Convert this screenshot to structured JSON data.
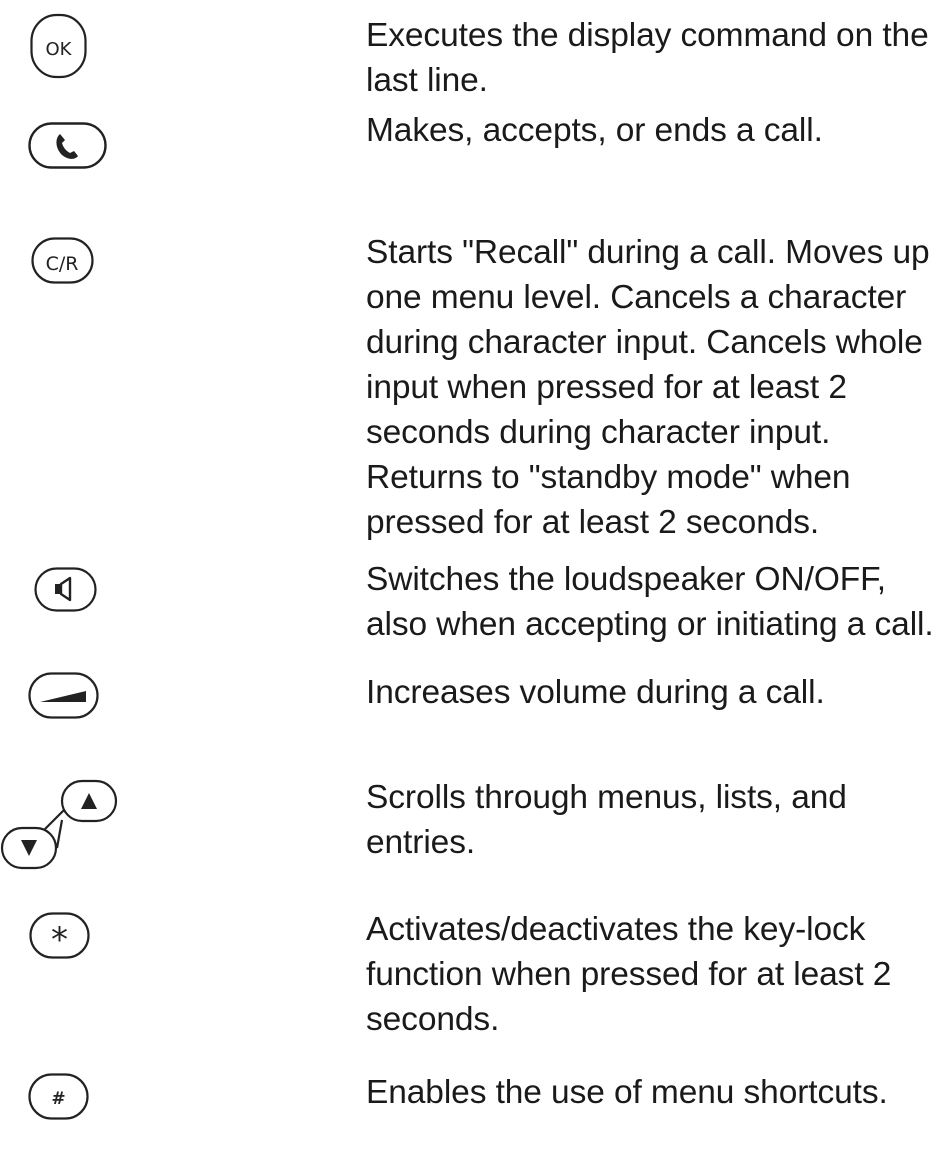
{
  "keys": [
    {
      "icon": "ok-key-icon",
      "glyph": "OK",
      "description": "Executes the display command on the\nlast line."
    },
    {
      "icon": "call-key-icon",
      "glyph": "",
      "description": "Makes, accepts, or ends a call."
    },
    {
      "icon": "clear-recall-key-icon",
      "glyph": "C/R",
      "description": "Starts \"Recall\" during a call. Moves up\none menu level. Cancels a character\nduring character input. Cancels whole\ninput when pressed for at least 2\nseconds during character input.\nReturns to \"standby mode\" when\npressed for at least 2 seconds."
    },
    {
      "icon": "loudspeaker-key-icon",
      "glyph": "",
      "description": "Switches the loudspeaker ON/OFF,\nalso when accepting or initiating a call."
    },
    {
      "icon": "volume-key-icon",
      "glyph": "",
      "description": "Increases volume during a call."
    },
    {
      "icon": "up-down-keys-icon",
      "glyph": "",
      "description": "Scrolls through menus, lists, and\nentries."
    },
    {
      "icon": "star-key-icon",
      "glyph": "*",
      "description": "Activates/deactivates the key-lock\nfunction when pressed for at least 2\nseconds."
    },
    {
      "icon": "hash-key-icon",
      "glyph": "#",
      "description": "Enables the use of menu shortcuts."
    }
  ]
}
